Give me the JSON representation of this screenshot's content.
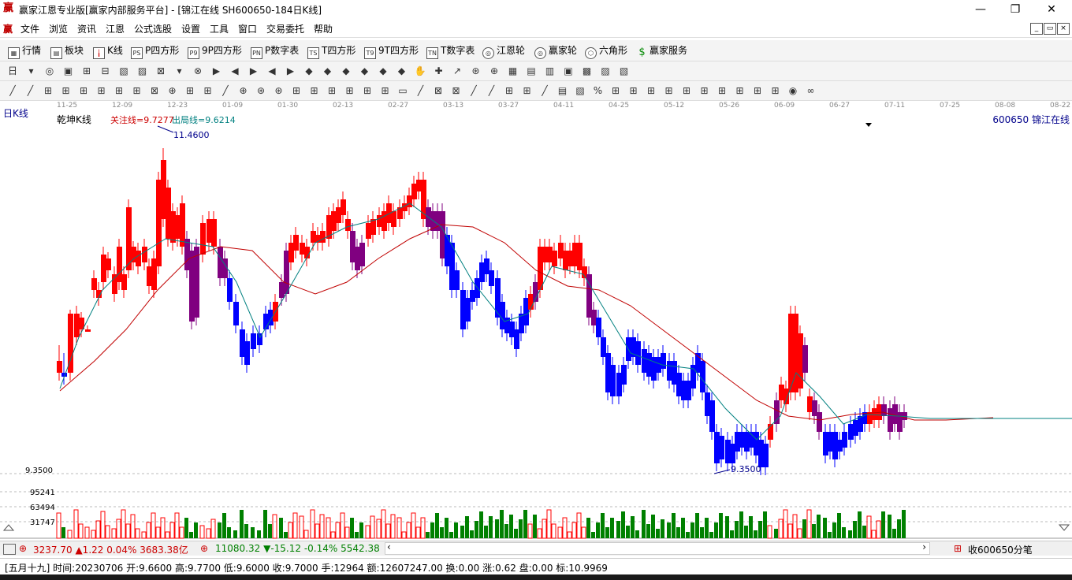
{
  "window": {
    "logo": "赢",
    "title": "赢家江恩专业版[赢家内部服务平台] - [锦江在线  SH600650-184日K线]",
    "minimize": "—",
    "restore": "❐",
    "close": "✕"
  },
  "menu": {
    "logo": "赢",
    "items": [
      "文件",
      "浏览",
      "资讯",
      "江恩",
      "公式选股",
      "设置",
      "工具",
      "窗口",
      "交易委托",
      "帮助"
    ],
    "mdi": [
      "_",
      "▭",
      "×"
    ]
  },
  "toolbar1": {
    "items": [
      {
        "icon": "grid-icon",
        "label": "行情"
      },
      {
        "icon": "block-icon",
        "label": "板块"
      },
      {
        "icon": "kline-icon",
        "label": "K线"
      },
      {
        "icon": "PS",
        "label": "P四方形"
      },
      {
        "icon": "P9",
        "label": "9P四方形"
      },
      {
        "icon": "PN",
        "label": "P数字表"
      },
      {
        "icon": "TS",
        "label": "T四方形"
      },
      {
        "icon": "T9",
        "label": "9T四方形"
      },
      {
        "icon": "TN",
        "label": "T数字表"
      },
      {
        "icon": "wheel-icon",
        "label": "江恩轮"
      },
      {
        "icon": "wheel-icon",
        "label": "赢家轮"
      },
      {
        "icon": "hexagon-icon",
        "label": "六角形"
      },
      {
        "icon": "dollar-icon",
        "label": "赢家服务"
      }
    ]
  },
  "chart_header": {
    "period": "日K线",
    "kname": "乾坤K线",
    "attention": "关注线=9.7277",
    "exit": "出局线=9.6214",
    "stock": "600650  锦江在线",
    "high_label": "11.4600",
    "low_label": "9.3500",
    "low_axis": "9.3500"
  },
  "colors": {
    "up": "#ff0000",
    "down": "#0000ff",
    "purple": "#800080",
    "volume_up": "#ff0000",
    "volume_down": "#008000",
    "ma_short": "#008080",
    "ma_long": "#c00000"
  },
  "chart_data": {
    "type": "candlestick",
    "x_ticks": [
      "11-25",
      "12-09",
      "12-23",
      "01-09",
      "01-30",
      "02-13",
      "02-27",
      "03-13",
      "03-27",
      "04-11",
      "04-25",
      "05-12",
      "05-26",
      "06-09",
      "06-27",
      "07-11",
      "07-25",
      "08-08",
      "08-22"
    ],
    "price_high": 11.46,
    "price_low": 9.35,
    "volume_ticks": [
      95241,
      63494,
      31747
    ],
    "volume_max": 126988
  },
  "status": {
    "sh_index": "3237.70",
    "sh_change": "▲1.22",
    "sh_pct": "0.04%",
    "sh_amount": "3683.38亿",
    "sz_index": "11080.32",
    "sz_change": "▼-15.12",
    "sz_pct": "-0.14%",
    "sz_amount": "5542.38",
    "collect": "收600650分笔"
  },
  "info": {
    "text": "[五月十九] 时间:20230706 开:9.6600 高:9.7700 低:9.6000 收:9.7000 手:12964 额:12607247.00 换:0.00 涨:0.62 盘:0.00 标:10.9969"
  }
}
